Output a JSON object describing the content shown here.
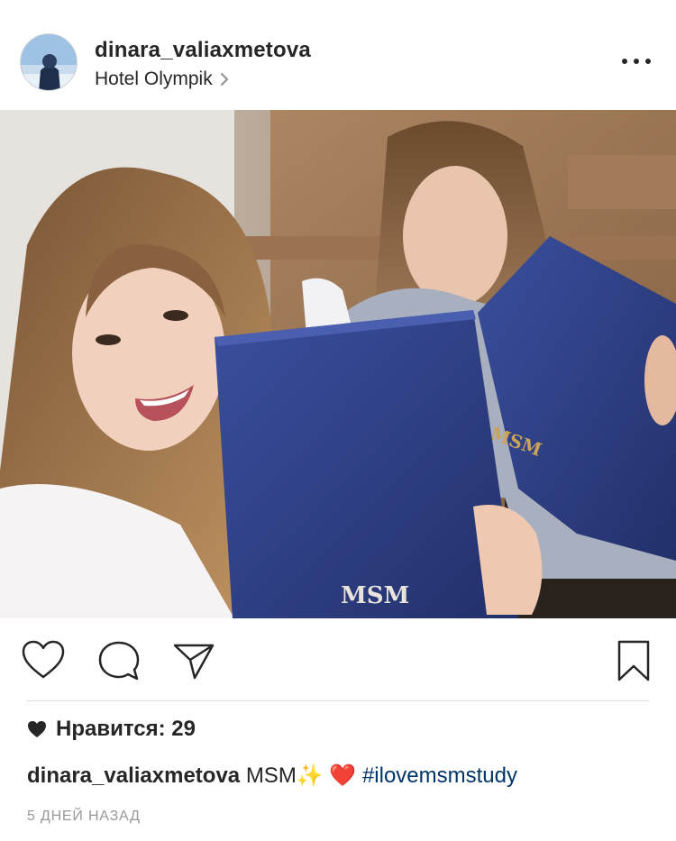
{
  "post": {
    "username": "dinara_valiaxmetova",
    "location": "Hotel Olympik",
    "likes_label": "Нравится: 29",
    "caption": {
      "username": "dinara_valiaxmetova",
      "text": "MSM",
      "emoji_sparkles": "✨",
      "emoji_heart": "❤️",
      "hashtag": "#ilovemsmstudy"
    },
    "time_ago": "5 ДНЕЙ НАЗАД"
  },
  "photo": {
    "folder_logo_text": "MSM"
  },
  "icons": {
    "like": "heart-outline-icon",
    "comment": "comment-bubble-icon",
    "share": "paper-plane-icon",
    "save": "bookmark-icon",
    "more": "more-dots-icon",
    "location_chevron": "chevron-right-icon"
  },
  "colors": {
    "text": "#262626",
    "hashtag": "#003569",
    "muted": "#999999",
    "divider": "#dbdbdb",
    "folder_blue": "#2c3d84"
  }
}
